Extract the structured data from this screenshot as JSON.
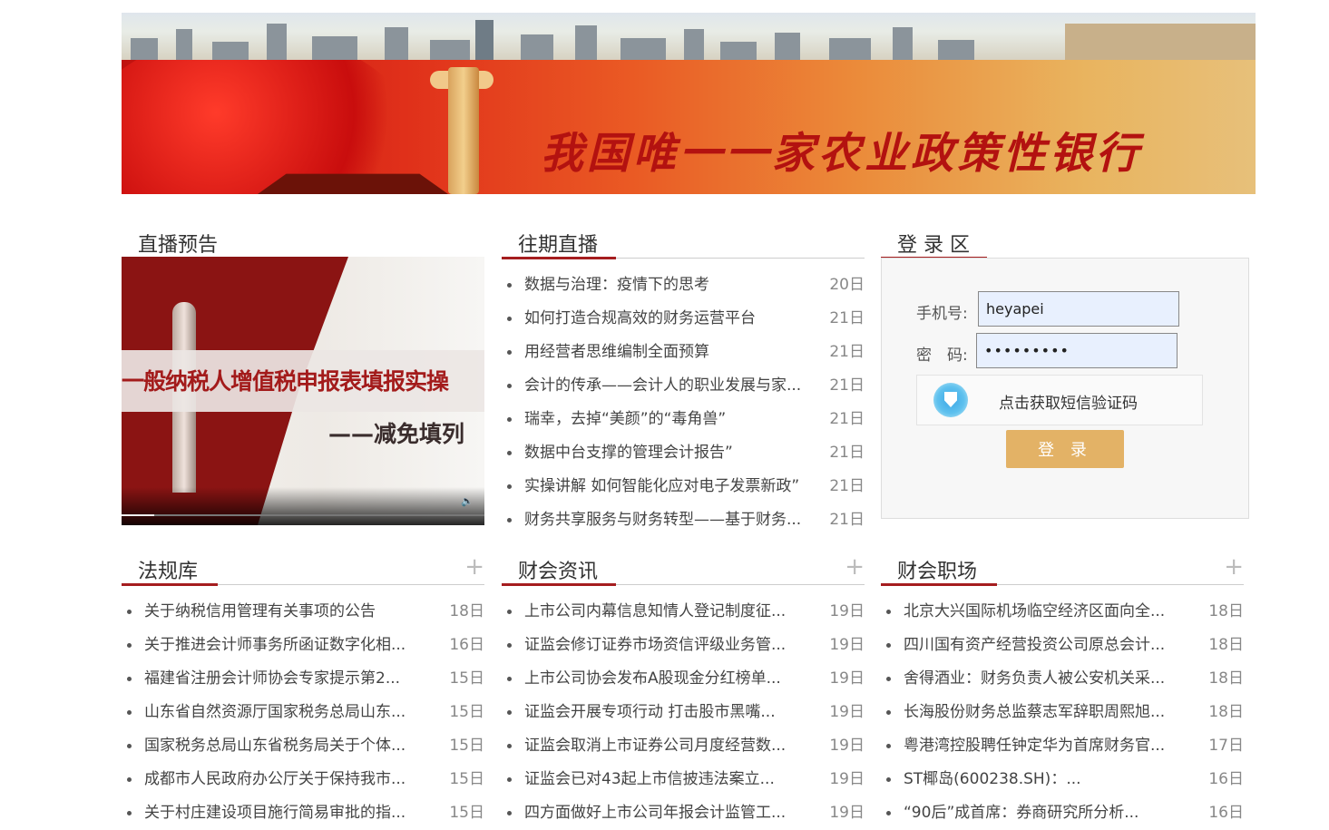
{
  "banner": {
    "slogan": "我国唯一一家农业政策性银行"
  },
  "live_preview": {
    "title": "直播预告",
    "video_title": "一般纳税人增值税申报表填报实操",
    "video_subtitle": "——减免填列"
  },
  "past_live": {
    "title": "往期直播",
    "items": [
      {
        "text": "数据与治理：疫情下的思考",
        "date": "20日"
      },
      {
        "text": "如何打造合规高效的财务运营平台",
        "date": "21日"
      },
      {
        "text": "用经营者思维编制全面预算",
        "date": "21日"
      },
      {
        "text": "会计的传承——会计人的职业发展与家...",
        "date": "21日"
      },
      {
        "text": "瑞幸，去掉“美颜”的“毒角兽”",
        "date": "21日"
      },
      {
        "text": "数据中台支撑的管理会计报告”",
        "date": "21日"
      },
      {
        "text": "实操讲解 如何智能化应对电子发票新政”",
        "date": "21日"
      },
      {
        "text": "财务共享服务与财务转型——基于财务...",
        "date": "21日"
      }
    ]
  },
  "login": {
    "title": "登 录 区",
    "phone_label": "手机号:",
    "phone_value": "heyapei",
    "password_label": "密　码:",
    "password_value": "•••••••••",
    "captcha_text": "点击获取短信验证码",
    "submit_label": "登 录"
  },
  "laws": {
    "title": "法规库",
    "more": "+",
    "items": [
      {
        "text": "关于纳税信用管理有关事项的公告",
        "date": "18日"
      },
      {
        "text": "关于推进会计师事务所函证数字化相...",
        "date": "16日"
      },
      {
        "text": "福建省注册会计师协会专家提示第2...",
        "date": "15日"
      },
      {
        "text": "山东省自然资源厅国家税务总局山东...",
        "date": "15日"
      },
      {
        "text": "国家税务总局山东省税务局关于个体...",
        "date": "15日"
      },
      {
        "text": "成都市人民政府办公厅关于保持我市...",
        "date": "15日"
      },
      {
        "text": "关于村庄建设项目施行简易审批的指...",
        "date": "15日"
      }
    ]
  },
  "news": {
    "title": "财会资讯",
    "more": "+",
    "items": [
      {
        "text": "上市公司内幕信息知情人登记制度征...",
        "date": "19日"
      },
      {
        "text": "证监会修订证券市场资信评级业务管...",
        "date": "19日"
      },
      {
        "text": "上市公司协会发布A股现金分红榜单...",
        "date": "19日"
      },
      {
        "text": "证监会开展专项行动 打击股市黑嘴...",
        "date": "19日"
      },
      {
        "text": "证监会取消上市证券公司月度经营数...",
        "date": "19日"
      },
      {
        "text": "证监会已对43起上市信披违法案立...",
        "date": "19日"
      },
      {
        "text": "四方面做好上市公司年报会计监管工...",
        "date": "19日"
      }
    ]
  },
  "jobs": {
    "title": "财会职场",
    "more": "+",
    "items": [
      {
        "text": "北京大兴国际机场临空经济区面向全...",
        "date": "18日"
      },
      {
        "text": "四川国有资产经营投资公司原总会计...",
        "date": "18日"
      },
      {
        "text": "舍得酒业：财务负责人被公安机关采...",
        "date": "18日"
      },
      {
        "text": "长海股份财务总监蔡志军辞职周熙旭...",
        "date": "18日"
      },
      {
        "text": "粤港湾控股聘任钟定华为首席财务官...",
        "date": "17日"
      },
      {
        "text": "ST椰岛(600238.SH)：...",
        "date": "16日"
      },
      {
        "text": "“90后”成首席：券商研究所分析...",
        "date": "16日"
      }
    ]
  }
}
